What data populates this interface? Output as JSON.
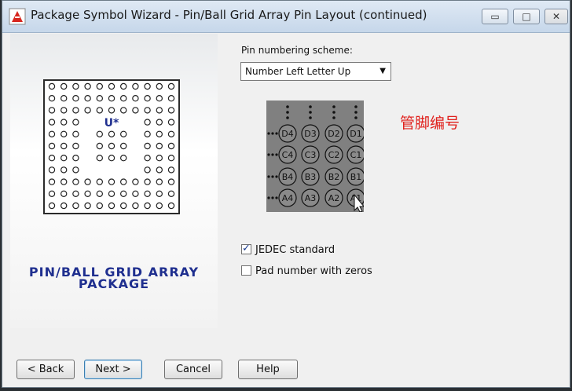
{
  "window": {
    "title": "Package Symbol Wizard - Pin/Ball Grid Array Pin Layout (continued)",
    "controls": {
      "minimize": "▭",
      "maximize": "□",
      "close": "✕"
    }
  },
  "left_panel": {
    "symbol_designator": "U*",
    "package_label_line1": "PIN/BALL GRID ARRAY",
    "package_label_line2": "PACKAGE"
  },
  "pin_numbering": {
    "label": "Pin numbering scheme:",
    "selected": "Number Left Letter Up"
  },
  "preview": {
    "rows": [
      [
        "D4",
        "D3",
        "D2",
        "D1"
      ],
      [
        "C4",
        "C3",
        "C2",
        "C1"
      ],
      [
        "B4",
        "B3",
        "B2",
        "B1"
      ],
      [
        "A4",
        "A3",
        "A2",
        "A1"
      ]
    ]
  },
  "annotation": "管脚编号",
  "options": {
    "jedec": {
      "label": "JEDEC standard",
      "checked": true
    },
    "pad_zeros": {
      "label": "Pad number with zeros",
      "checked": false
    }
  },
  "buttons": {
    "back": "< Back",
    "next": "Next >",
    "cancel": "Cancel",
    "help": "Help"
  },
  "colors": {
    "package_label": "#1f2f8f",
    "annotation": "#e0201c",
    "preview_bg": "#808080"
  }
}
